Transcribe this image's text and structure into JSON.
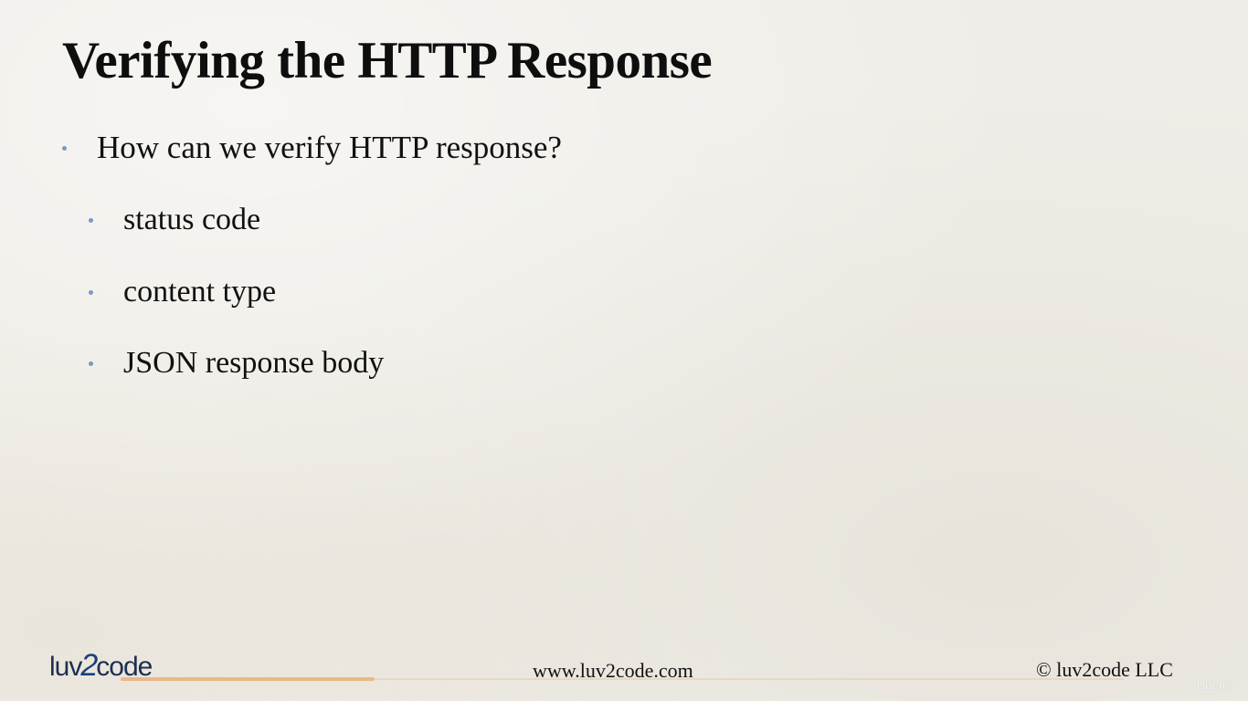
{
  "slide": {
    "title": "Verifying the HTTP Response",
    "bullets": [
      {
        "level": 1,
        "text": "How can we verify HTTP response?"
      },
      {
        "level": 2,
        "text": "status code"
      },
      {
        "level": 2,
        "text": "content type"
      },
      {
        "level": 2,
        "text": "JSON response body"
      }
    ]
  },
  "footer": {
    "logo_left": "luv",
    "logo_digit": "2",
    "logo_right": "code",
    "url": "www.luv2code.com",
    "copyright": "© luv2code LLC"
  },
  "watermark": "Udemy",
  "colors": {
    "background": "#efede7",
    "text": "#111111",
    "bullet": "#7e96c4",
    "logo": "#1c2f52",
    "accent_line": "#e8b986"
  }
}
